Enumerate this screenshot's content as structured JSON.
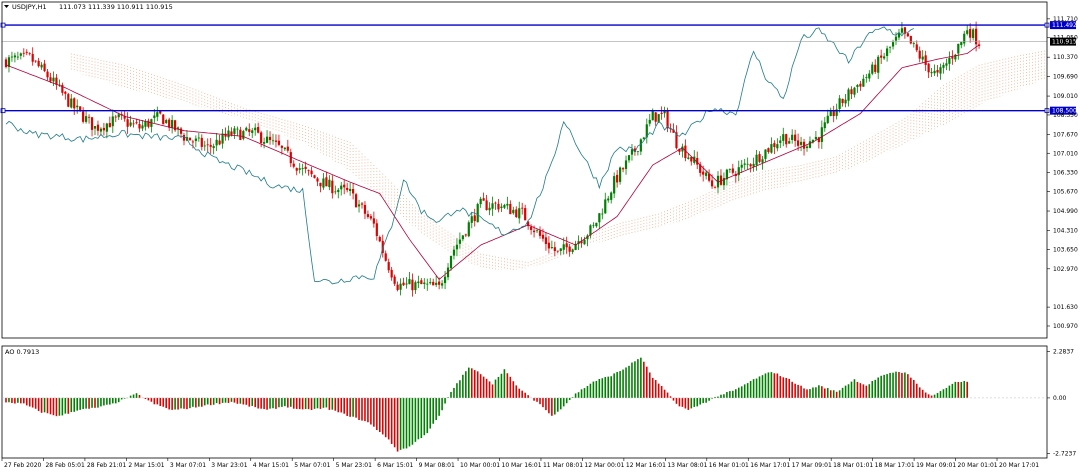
{
  "chart_data": {
    "type": "candlestick",
    "main": {
      "symbol_title": "USDJPY,H1",
      "ohlc_text": "111.073 111.339 110.911 110.915",
      "ylim": [
        100.55,
        111.95
      ],
      "y_ticks": [
        "111.710",
        "111.050",
        "110.370",
        "109.690",
        "109.010",
        "108.350",
        "107.670",
        "107.010",
        "106.330",
        "105.670",
        "104.990",
        "104.310",
        "103.650",
        "102.970",
        "101.630",
        "100.970"
      ],
      "y_tick_values": [
        111.71,
        111.05,
        110.37,
        109.69,
        109.01,
        108.35,
        107.67,
        107.01,
        106.33,
        105.67,
        104.99,
        104.31,
        103.65,
        102.97,
        101.63,
        100.97
      ],
      "hlines": [
        {
          "value": 111.492,
          "label": "111.492",
          "color": "#0000cc"
        },
        {
          "value": 108.5,
          "label": "108.500",
          "color": "#0000cc"
        }
      ],
      "bid_line": {
        "value": 110.915,
        "label": "110.915"
      },
      "candle_count": 200,
      "price_anchors": [
        [
          0,
          110.25
        ],
        [
          8,
          110.35
        ],
        [
          15,
          109.6
        ],
        [
          22,
          108.7
        ],
        [
          30,
          107.9
        ],
        [
          38,
          108.2
        ],
        [
          45,
          107.9
        ],
        [
          52,
          108.3
        ],
        [
          60,
          107.6
        ],
        [
          68,
          107.2
        ],
        [
          76,
          107.7
        ],
        [
          84,
          107.7
        ],
        [
          92,
          107.2
        ],
        [
          100,
          106.4
        ],
        [
          108,
          105.9
        ],
        [
          116,
          105.6
        ],
        [
          124,
          104.5
        ],
        [
          128,
          103.3
        ],
        [
          132,
          102.4
        ],
        [
          140,
          102.4
        ],
        [
          146,
          102.3
        ],
        [
          150,
          103.5
        ],
        [
          160,
          105.2
        ],
        [
          166,
          105.2
        ],
        [
          174,
          104.9
        ],
        [
          180,
          104.1
        ],
        [
          186,
          103.5
        ],
        [
          192,
          103.9
        ],
        [
          198,
          104.4
        ],
        [
          205,
          106.0
        ],
        [
          212,
          107.1
        ],
        [
          218,
          108.3
        ],
        [
          222,
          108.3
        ],
        [
          226,
          107.4
        ],
        [
          232,
          106.7
        ],
        [
          238,
          105.9
        ],
        [
          244,
          106.3
        ],
        [
          250,
          106.6
        ],
        [
          256,
          107.1
        ],
        [
          262,
          107.6
        ],
        [
          268,
          107.3
        ],
        [
          274,
          107.6
        ],
        [
          280,
          108.6
        ],
        [
          286,
          109.3
        ],
        [
          292,
          109.9
        ],
        [
          298,
          110.7
        ],
        [
          302,
          111.2
        ],
        [
          306,
          110.7
        ],
        [
          310,
          110.1
        ],
        [
          314,
          109.7
        ],
        [
          318,
          110.3
        ],
        [
          322,
          110.9
        ],
        [
          324,
          111.4
        ],
        [
          328,
          110.9
        ]
      ],
      "ma_anchors": [
        [
          0,
          110.1
        ],
        [
          20,
          109.3
        ],
        [
          40,
          108.3
        ],
        [
          60,
          107.8
        ],
        [
          80,
          107.6
        ],
        [
          100,
          106.7
        ],
        [
          116,
          106.0
        ],
        [
          126,
          105.6
        ],
        [
          136,
          104.0
        ],
        [
          146,
          102.6
        ],
        [
          160,
          103.8
        ],
        [
          176,
          104.5
        ],
        [
          192,
          103.8
        ],
        [
          206,
          104.8
        ],
        [
          218,
          106.6
        ],
        [
          228,
          107.2
        ],
        [
          240,
          106.0
        ],
        [
          256,
          106.7
        ],
        [
          272,
          107.4
        ],
        [
          288,
          108.4
        ],
        [
          302,
          110.0
        ],
        [
          314,
          110.3
        ],
        [
          324,
          110.5
        ],
        [
          328,
          110.8
        ]
      ],
      "chikou_anchors": [
        [
          0,
          108.1
        ],
        [
          8,
          107.7
        ],
        [
          18,
          107.6
        ],
        [
          26,
          107.5
        ],
        [
          38,
          107.7
        ],
        [
          48,
          107.6
        ],
        [
          60,
          107.5
        ],
        [
          70,
          106.8
        ],
        [
          80,
          106.4
        ],
        [
          90,
          105.9
        ],
        [
          100,
          105.7
        ],
        [
          104,
          102.6
        ],
        [
          110,
          102.5
        ],
        [
          118,
          102.7
        ],
        [
          124,
          102.7
        ],
        [
          130,
          104.5
        ],
        [
          134,
          106.1
        ],
        [
          140,
          105.0
        ],
        [
          146,
          104.6
        ],
        [
          152,
          105.1
        ],
        [
          160,
          104.7
        ],
        [
          168,
          104.2
        ],
        [
          176,
          104.6
        ],
        [
          184,
          106.6
        ],
        [
          188,
          108.2
        ],
        [
          194,
          107.0
        ],
        [
          200,
          105.9
        ],
        [
          206,
          107.2
        ],
        [
          212,
          107.1
        ],
        [
          220,
          108.0
        ],
        [
          228,
          107.6
        ],
        [
          238,
          108.6
        ],
        [
          246,
          108.4
        ],
        [
          252,
          110.6
        ],
        [
          256,
          109.7
        ],
        [
          262,
          108.9
        ],
        [
          268,
          111.0
        ],
        [
          274,
          111.3
        ],
        [
          280,
          110.7
        ],
        [
          284,
          110.2
        ],
        [
          290,
          111.1
        ],
        [
          296,
          111.4
        ],
        [
          300,
          111.2
        ],
        [
          304,
          111.2
        ],
        [
          306,
          111.3
        ]
      ],
      "cloud_a_anchors": [
        [
          22,
          110.5
        ],
        [
          40,
          110.1
        ],
        [
          60,
          109.4
        ],
        [
          80,
          108.6
        ],
        [
          100,
          108.0
        ],
        [
          116,
          107.4
        ],
        [
          128,
          106.2
        ],
        [
          140,
          104.9
        ],
        [
          150,
          104.2
        ],
        [
          160,
          103.5
        ],
        [
          170,
          103.3
        ],
        [
          176,
          103.2
        ],
        [
          186,
          103.6
        ],
        [
          196,
          104.2
        ],
        [
          208,
          104.6
        ],
        [
          220,
          104.9
        ],
        [
          232,
          105.4
        ],
        [
          244,
          106.0
        ],
        [
          256,
          106.4
        ],
        [
          268,
          106.6
        ],
        [
          280,
          106.9
        ],
        [
          292,
          107.6
        ],
        [
          304,
          108.3
        ],
        [
          316,
          109.4
        ],
        [
          328,
          110.1
        ],
        [
          340,
          110.4
        ],
        [
          350,
          110.6
        ]
      ],
      "cloud_b_anchors": [
        [
          22,
          109.9
        ],
        [
          40,
          109.3
        ],
        [
          60,
          108.8
        ],
        [
          80,
          108.2
        ],
        [
          100,
          107.4
        ],
        [
          116,
          106.4
        ],
        [
          128,
          105.3
        ],
        [
          140,
          104.2
        ],
        [
          150,
          103.5
        ],
        [
          160,
          103.0
        ],
        [
          170,
          102.9
        ],
        [
          176,
          103.0
        ],
        [
          186,
          103.3
        ],
        [
          196,
          103.8
        ],
        [
          208,
          104.1
        ],
        [
          220,
          104.4
        ],
        [
          232,
          104.8
        ],
        [
          244,
          105.3
        ],
        [
          256,
          105.7
        ],
        [
          268,
          106.0
        ],
        [
          280,
          106.3
        ],
        [
          292,
          106.8
        ],
        [
          304,
          107.4
        ],
        [
          316,
          108.0
        ],
        [
          328,
          108.7
        ],
        [
          340,
          109.2
        ],
        [
          350,
          109.6
        ]
      ]
    },
    "sub": {
      "title": "AO 0.7913",
      "ylim": [
        -2.85,
        2.4
      ],
      "y_ticks": [
        "2.2837",
        "0.00",
        "-2.7237"
      ],
      "y_tick_values": [
        2.2837,
        0.0,
        -2.7237
      ],
      "ao_anchors": [
        [
          0,
          -0.2
        ],
        [
          6,
          -0.3
        ],
        [
          12,
          -0.7
        ],
        [
          18,
          -0.9
        ],
        [
          24,
          -0.6
        ],
        [
          30,
          -0.5
        ],
        [
          36,
          -0.3
        ],
        [
          44,
          0.2
        ],
        [
          50,
          -0.3
        ],
        [
          56,
          -0.6
        ],
        [
          62,
          -0.5
        ],
        [
          70,
          -0.3
        ],
        [
          76,
          -0.2
        ],
        [
          82,
          -0.4
        ],
        [
          88,
          -0.6
        ],
        [
          94,
          -0.4
        ],
        [
          100,
          -0.6
        ],
        [
          108,
          -0.5
        ],
        [
          114,
          -0.8
        ],
        [
          122,
          -1.2
        ],
        [
          128,
          -1.9
        ],
        [
          132,
          -2.6
        ],
        [
          136,
          -2.4
        ],
        [
          142,
          -1.7
        ],
        [
          146,
          -0.9
        ],
        [
          150,
          0.3
        ],
        [
          156,
          1.5
        ],
        [
          160,
          1.2
        ],
        [
          164,
          0.7
        ],
        [
          168,
          1.4
        ],
        [
          172,
          0.6
        ],
        [
          176,
          0.1
        ],
        [
          180,
          -0.3
        ],
        [
          184,
          -0.9
        ],
        [
          188,
          -0.4
        ],
        [
          192,
          0.2
        ],
        [
          198,
          0.8
        ],
        [
          204,
          1.1
        ],
        [
          208,
          1.4
        ],
        [
          214,
          2.0
        ],
        [
          218,
          1.0
        ],
        [
          222,
          0.4
        ],
        [
          226,
          -0.3
        ],
        [
          230,
          -0.6
        ],
        [
          236,
          -0.2
        ],
        [
          240,
          0.1
        ],
        [
          246,
          0.4
        ],
        [
          252,
          0.9
        ],
        [
          258,
          1.3
        ],
        [
          264,
          0.9
        ],
        [
          270,
          0.4
        ],
        [
          274,
          0.6
        ],
        [
          280,
          0.3
        ],
        [
          286,
          0.9
        ],
        [
          290,
          0.6
        ],
        [
          294,
          1.0
        ],
        [
          300,
          1.3
        ],
        [
          304,
          1.2
        ],
        [
          308,
          0.5
        ],
        [
          312,
          0.1
        ],
        [
          316,
          0.4
        ],
        [
          320,
          0.8
        ],
        [
          324,
          0.8
        ]
      ]
    },
    "x_labels": [
      "27 Feb 2020",
      "28 Feb 05:01",
      "28 Feb 21:01",
      "2 Mar 15:01",
      "3 Mar 07:01",
      "3 Mar 23:01",
      "4 Mar 15:01",
      "5 Mar 07:01",
      "5 Mar 23:01",
      "6 Mar 15:01",
      "9 Mar 08:01",
      "10 Mar 00:01",
      "10 Mar 16:01",
      "11 Mar 08:01",
      "12 Mar 00:01",
      "12 Mar 16:01",
      "13 Mar 08:01",
      "16 Mar 01:01",
      "16 Mar 17:01",
      "17 Mar 09:01",
      "18 Mar 01:01",
      "18 Mar 17:01",
      "19 Mar 09:01",
      "20 Mar 01:01",
      "20 Mar 17:01"
    ],
    "colors": {
      "bull": "#008000",
      "bear": "#e00000",
      "ma": "#b0003a",
      "chikou": "#1f7a8c",
      "cloud_a": "#f0b090",
      "cloud_b": "#e8b0c0",
      "hline": "#0000cc",
      "grid": "#c8c8c8"
    }
  }
}
